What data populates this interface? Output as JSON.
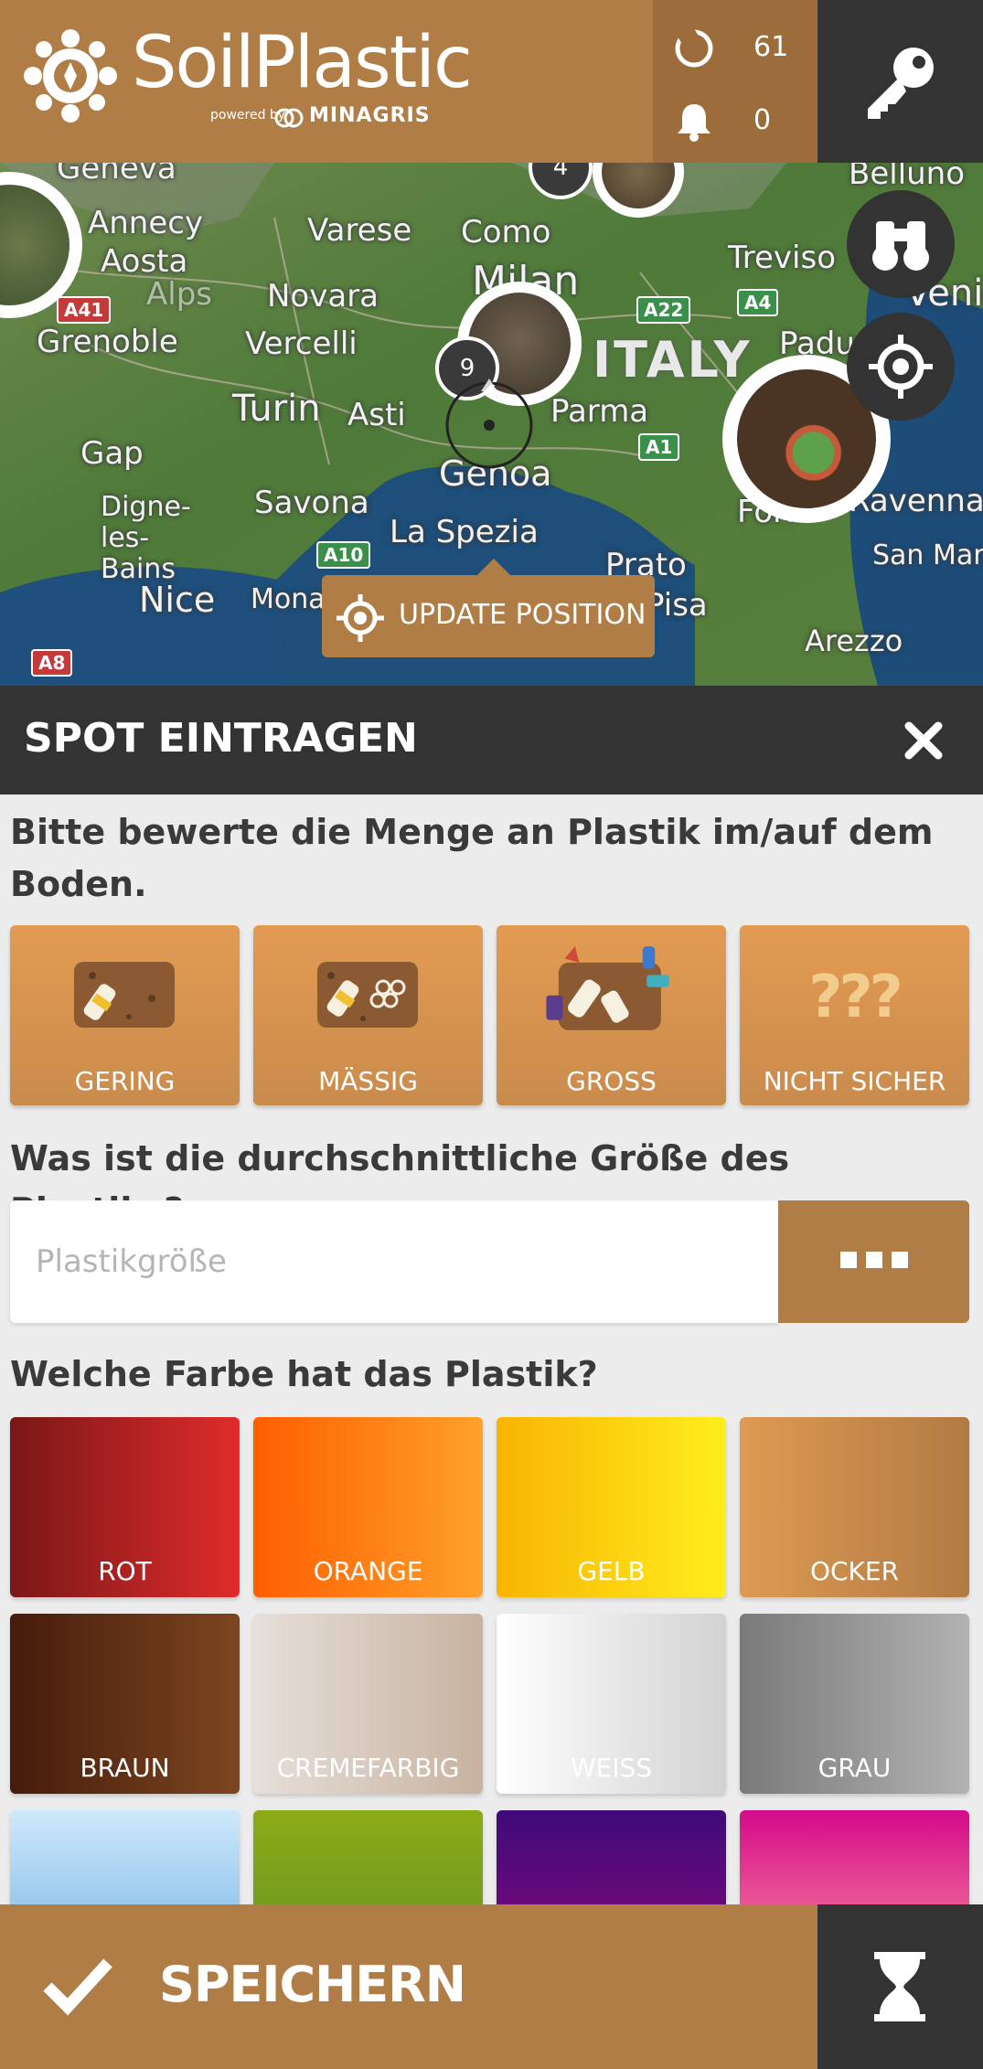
{
  "header": {
    "logo_text": "SoilPlastic",
    "powered_by": "powered by",
    "partner": "MINAGRIS",
    "counters": [
      {
        "icon": "spots-icon",
        "value": "61"
      },
      {
        "icon": "bell-icon",
        "value": "0"
      }
    ],
    "key_icon": "key-icon"
  },
  "map": {
    "cities": [
      "Geneva",
      "Annecy",
      "Aosta",
      "Alps",
      "Grenoble",
      "Varese",
      "Como",
      "Milan",
      "Novara",
      "Vercelli",
      "Turin",
      "Asti",
      "Gap",
      "Digne-les-Bains",
      "Savona",
      "Genoa",
      "La Spezia",
      "Nice",
      "Monaco",
      "Belluno",
      "Treviso",
      "Venice",
      "Padua",
      "Parma",
      "Prato",
      "Pisa",
      "Forlì",
      "Ravenna",
      "San Marino",
      "Arezzo"
    ],
    "country": "ITALY",
    "roads": [
      "A41",
      "A10",
      "A8",
      "A22",
      "A4",
      "A1"
    ],
    "clusters": [
      "4",
      "9"
    ],
    "update_label": "UPDATE POSITION"
  },
  "panel": {
    "title": "SPOT EINTRAGEN",
    "close_icon": "close-icon"
  },
  "amount": {
    "question": "Bitte bewerte die Menge an Plastik im/auf dem Boden.",
    "options": [
      {
        "label": "GERING",
        "icon": "low-plastic-icon"
      },
      {
        "label": "MÄSSIG",
        "icon": "medium-plastic-icon"
      },
      {
        "label": "GROSS",
        "icon": "high-plastic-icon"
      },
      {
        "label": "NICHT SICHER",
        "icon": "question-marks-icon"
      }
    ]
  },
  "size": {
    "question": "Was ist die durchschnittliche Größe des Plastiks?",
    "placeholder": "Plastikgröße",
    "more_icon": "more-icon"
  },
  "color": {
    "question": "Welche Farbe hat das Plastik?",
    "options": [
      {
        "label": "ROT",
        "from": "#7a1717",
        "to": "#e02b2b"
      },
      {
        "label": "ORANGE",
        "from": "#ff5e00",
        "to": "#ffa12a"
      },
      {
        "label": "GELB",
        "from": "#f8b400",
        "to": "#ffee1f"
      },
      {
        "label": "OCKER",
        "from": "#dd9a52",
        "to": "#b27a43"
      },
      {
        "label": "BRAUN",
        "from": "#451c0b",
        "to": "#7c4620"
      },
      {
        "label": "CREMEFARBIG",
        "from": "#e6e0da",
        "to": "#c8b2a0"
      },
      {
        "label": "WEISS",
        "from": "#ffffff",
        "to": "#d2d2d2"
      },
      {
        "label": "GRAU",
        "from": "#7a7a7a",
        "to": "#b2b2b2"
      },
      {
        "label": "",
        "from": "#cfe8fb",
        "to": "#6aaee0"
      },
      {
        "label": "",
        "from": "#8cab18",
        "to": "#5f8f24"
      },
      {
        "label": "",
        "from": "#3f0a7a",
        "to": "#8e0a7a"
      },
      {
        "label": "",
        "from": "#d40a8a",
        "to": "#ff9aa0"
      }
    ]
  },
  "footer": {
    "save_label": "SPEICHERN",
    "timer_icon": "hourglass-icon"
  }
}
